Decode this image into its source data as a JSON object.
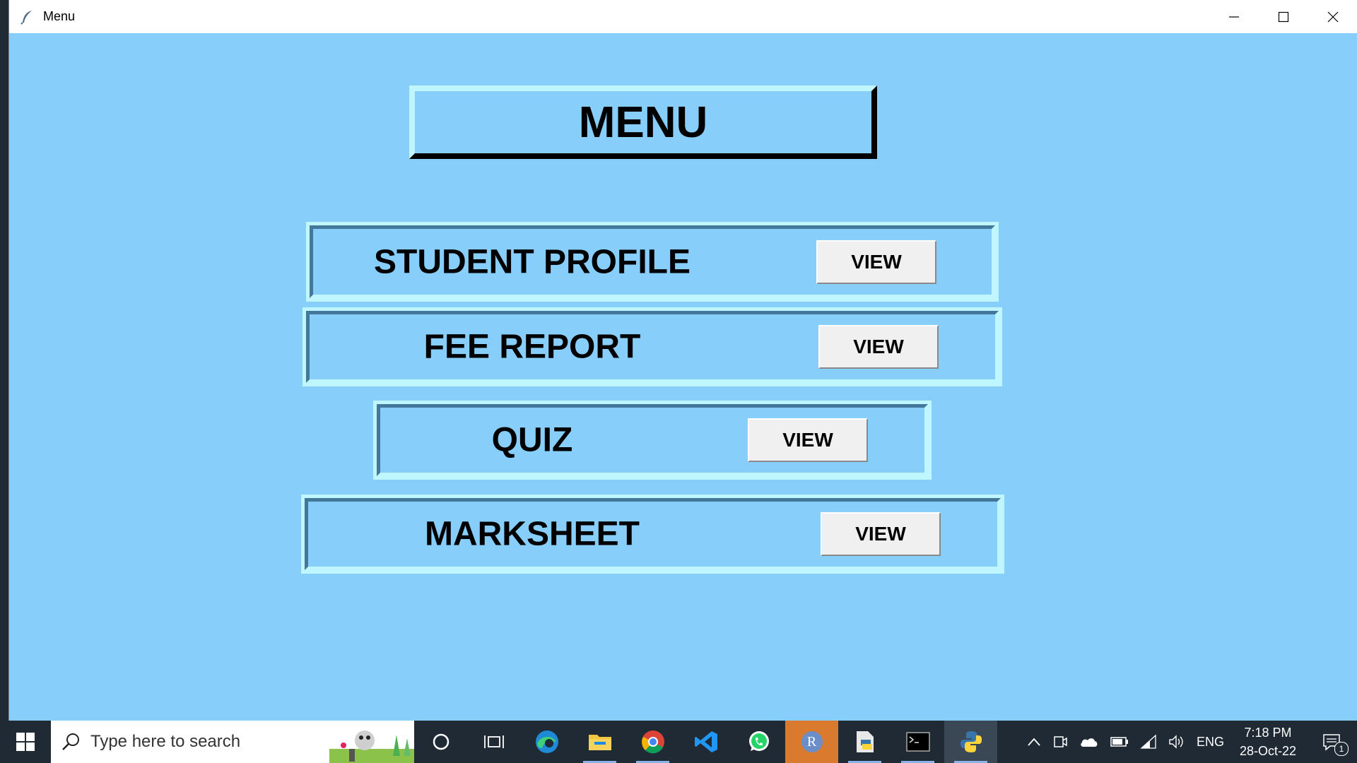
{
  "window": {
    "title": "Menu",
    "controls": [
      "minimize-icon",
      "maximize-icon",
      "close-icon"
    ]
  },
  "menu": {
    "title": "MENU",
    "rows": [
      {
        "label": "STUDENT PROFILE",
        "button": "VIEW"
      },
      {
        "label": "FEE REPORT",
        "button": "VIEW"
      },
      {
        "label": "QUIZ",
        "button": "VIEW"
      },
      {
        "label": "MARKSHEET",
        "button": "VIEW"
      }
    ]
  },
  "taskbar": {
    "search_placeholder": "Type here to search",
    "apps": [
      "cortana-icon",
      "task-view-icon",
      "edge-icon",
      "file-explorer-icon",
      "chrome-icon",
      "vscode-icon",
      "whatsapp-icon",
      "r-icon",
      "python-file-icon",
      "terminal-icon",
      "python-icon"
    ],
    "r_label": "R",
    "tray": {
      "language": "ENG",
      "time": "7:18 PM",
      "date": "28-Oct-22",
      "notification_count": "1"
    }
  },
  "colors": {
    "window_bg": "#87cefa",
    "frame_light": "#bff6ff",
    "frame_dark": "#43789a",
    "button_bg": "#f0f0f0"
  }
}
